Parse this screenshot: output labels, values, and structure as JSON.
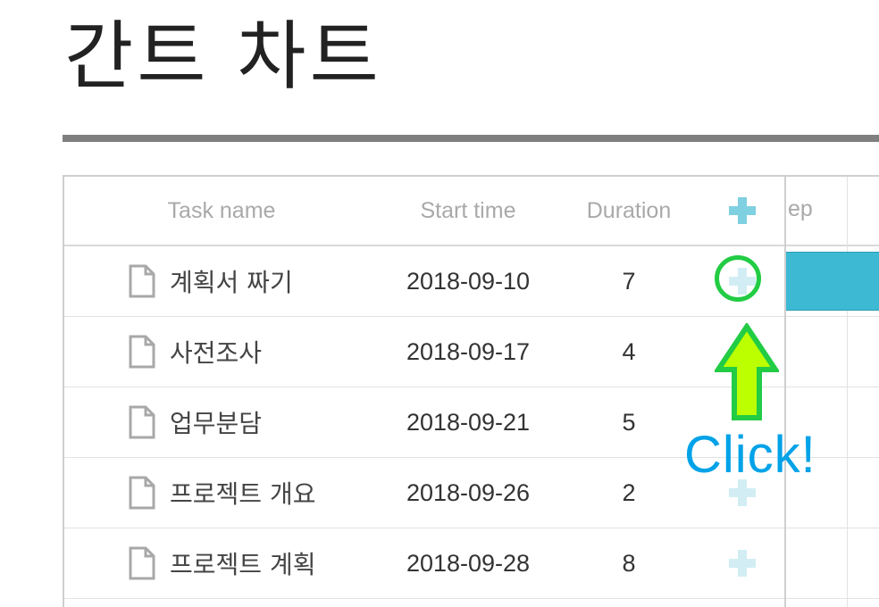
{
  "page": {
    "title": "간트 차트"
  },
  "grid": {
    "columns": {
      "task_name": "Task name",
      "start_time": "Start time",
      "duration": "Duration"
    },
    "add_icon": "plus-icon"
  },
  "scale": {
    "label": "ep"
  },
  "tasks": [
    {
      "name": "계획서 짜기",
      "start": "2018-09-10",
      "duration": "7"
    },
    {
      "name": "사전조사",
      "start": "2018-09-17",
      "duration": "4"
    },
    {
      "name": "업무분담",
      "start": "2018-09-21",
      "duration": "5"
    },
    {
      "name": "프로젝트 개요",
      "start": "2018-09-26",
      "duration": "2"
    },
    {
      "name": "프로젝트 계획",
      "start": "2018-09-28",
      "duration": "8"
    }
  ],
  "annotation": {
    "label": "Click!"
  },
  "colors": {
    "bar": "#3db9d3",
    "plus": "#7fd0e0",
    "highlight": "#22cc44",
    "arrow_fill": "#bbff00",
    "annotation_text": "#00a2e8"
  }
}
